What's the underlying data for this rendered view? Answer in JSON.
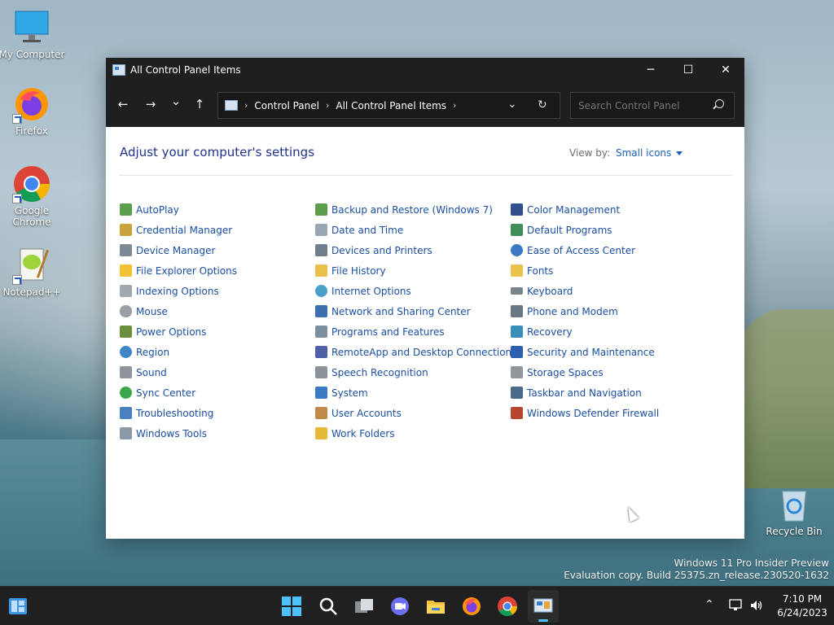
{
  "desktop": {
    "icons": [
      {
        "label": "My Computer"
      },
      {
        "label": "Firefox"
      },
      {
        "label": "Google Chrome"
      },
      {
        "label": "Notepad++"
      },
      {
        "label": "Recycle Bin"
      }
    ],
    "watermark": {
      "line1": "Windows 11 Pro Insider Preview",
      "line2": "Evaluation copy. Build 25375.zn_release.230520-1632"
    }
  },
  "window": {
    "title": "All Control Panel Items",
    "controls": {
      "minimize": "─",
      "maximize": "☐",
      "close": "✕"
    },
    "nav": {
      "back": "←",
      "forward": "→",
      "recent": "⌄",
      "up": "↑",
      "refresh": "↻",
      "dropdown": "⌄"
    },
    "breadcrumb": [
      "Control Panel",
      "All Control Panel Items"
    ],
    "search": {
      "placeholder": "Search Control Panel"
    },
    "heading": "Adjust your computer's settings",
    "view_by_label": "View by:",
    "view_by_value": "Small icons",
    "items": {
      "col1": [
        "AutoPlay",
        "Credential Manager",
        "Device Manager",
        "File Explorer Options",
        "Indexing Options",
        "Mouse",
        "Power Options",
        "Region",
        "Sound",
        "Sync Center",
        "Troubleshooting",
        "Windows Tools"
      ],
      "col2": [
        "Backup and Restore (Windows 7)",
        "Date and Time",
        "Devices and Printers",
        "File History",
        "Internet Options",
        "Network and Sharing Center",
        "Programs and Features",
        "RemoteApp and Desktop Connections",
        "Speech Recognition",
        "System",
        "User Accounts",
        "Work Folders"
      ],
      "col3": [
        "Color Management",
        "Default Programs",
        "Ease of Access Center",
        "Fonts",
        "Keyboard",
        "Phone and Modem",
        "Recovery",
        "Security and Maintenance",
        "Storage Spaces",
        "Taskbar and Navigation",
        "Windows Defender Firewall"
      ]
    }
  },
  "taskbar": {
    "time": "7:10 PM",
    "date": "6/24/2023"
  },
  "colors": {
    "link": "#1a4ea0",
    "heading": "#1e3287",
    "titlebar": "#1f1f1f",
    "taskbar": "#202020"
  }
}
